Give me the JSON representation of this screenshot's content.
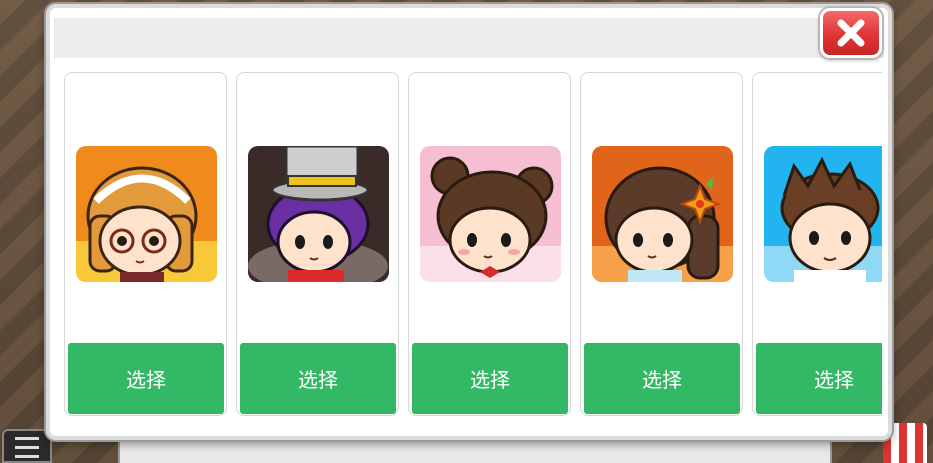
{
  "dialog": {
    "close_icon": "close-x-icon"
  },
  "characters": [
    {
      "name": "girl-glasses-headband",
      "bg": "#f08a1c",
      "hair": "#e29a3a",
      "select_label": "选择"
    },
    {
      "name": "boy-top-hat",
      "bg": "#3a2a28",
      "hair": "#6a2fa3",
      "select_label": "选择"
    },
    {
      "name": "girl-hair-buns",
      "bg": "#f6bfd1",
      "hair": "#5a3a24",
      "select_label": "选择"
    },
    {
      "name": "girl-flower-hairpin",
      "bg": "#e0641a",
      "hair": "#5b3b2a",
      "select_label": "选择"
    },
    {
      "name": "man-brown-hair",
      "bg": "#22b4ee",
      "hair": "#6b3f25",
      "select_label": "选择"
    }
  ],
  "colors": {
    "select_button": "#33b865",
    "close_button": "#e03434"
  }
}
